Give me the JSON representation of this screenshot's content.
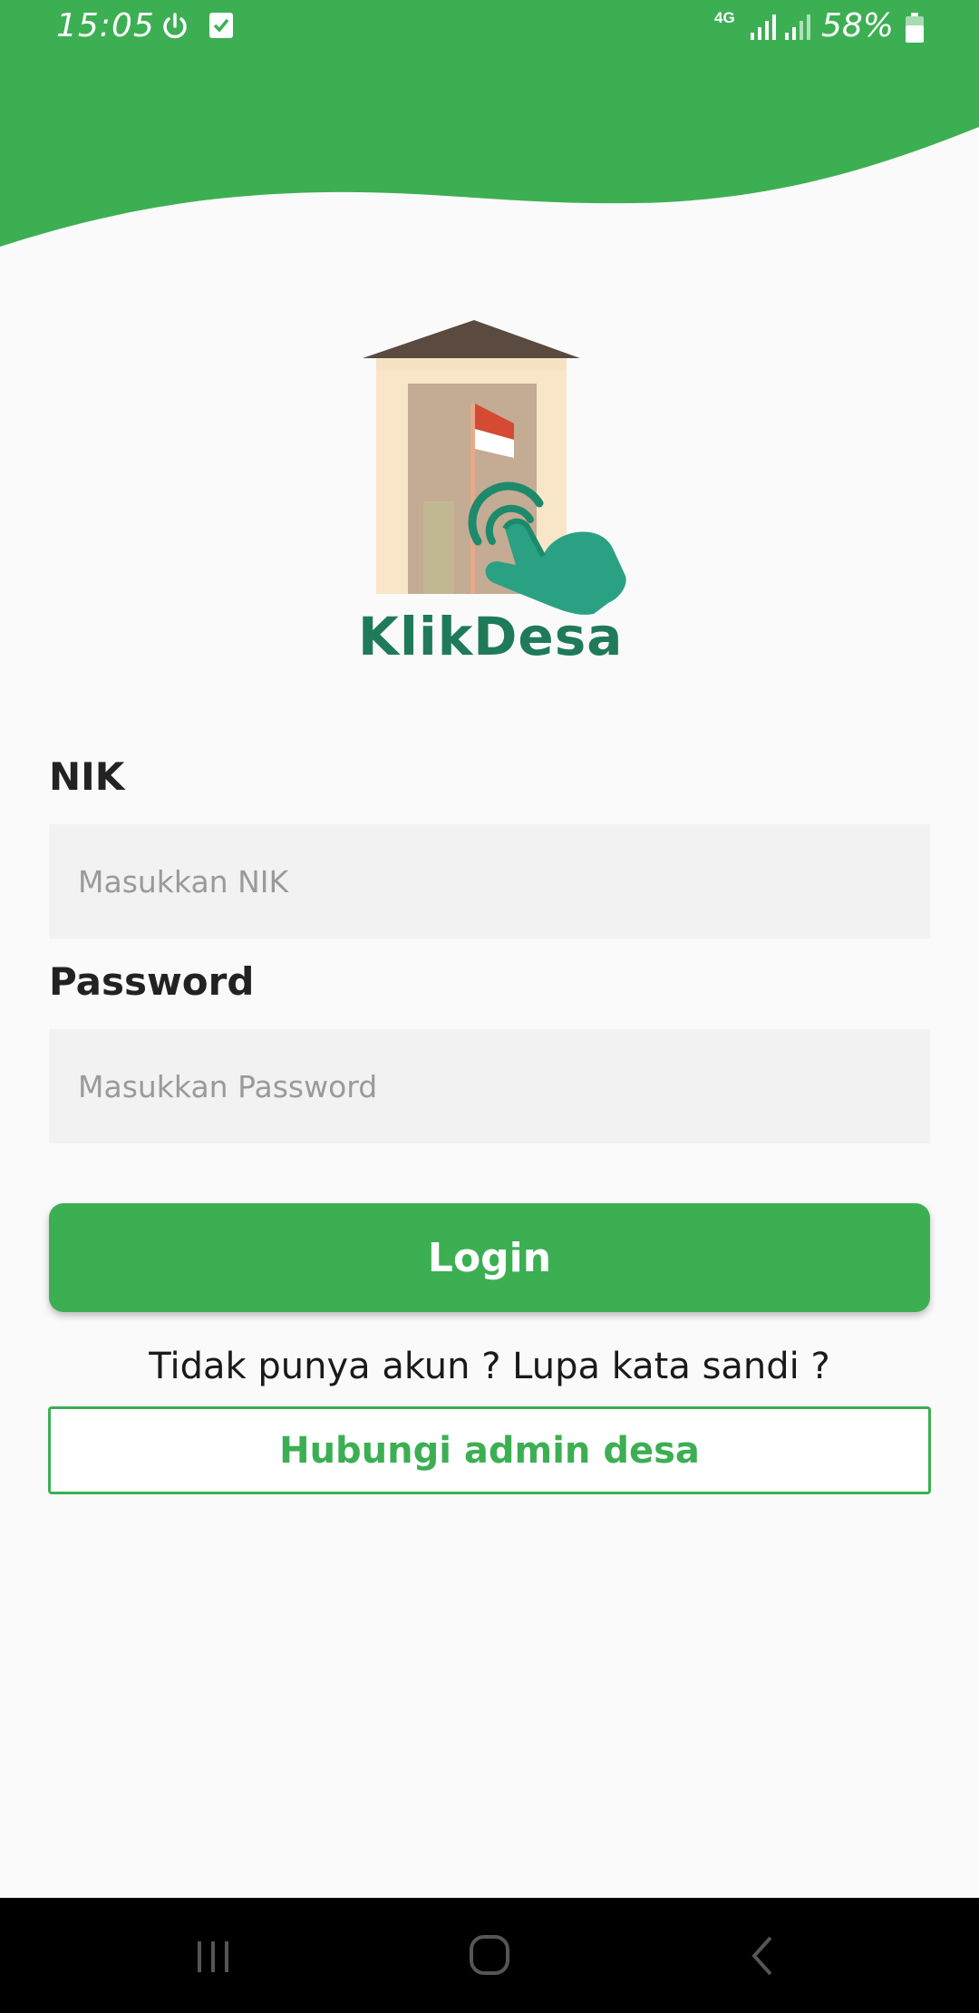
{
  "status_bar": {
    "time": "15:05",
    "network": "4G",
    "battery": "58%",
    "icons": [
      "power-icon",
      "checkbox-icon",
      "network-4g-icon",
      "signal-icon",
      "signal-icon",
      "battery-icon"
    ]
  },
  "app": {
    "logo_text": "KlikDesa",
    "brand_color": "#3caf53",
    "logo_text_color": "#1f7a5a"
  },
  "form": {
    "nik_label": "NIK",
    "nik_placeholder": "Masukkan NIK",
    "password_label": "Password",
    "password_placeholder": "Masukkan Password",
    "login_label": "Login"
  },
  "footer": {
    "help_text": "Tidak punya akun ? Lupa kata sandi ?",
    "contact_label": "Hubungi admin desa"
  },
  "nav_bar": {
    "icons": [
      "recents-icon",
      "home-icon",
      "back-icon"
    ]
  }
}
